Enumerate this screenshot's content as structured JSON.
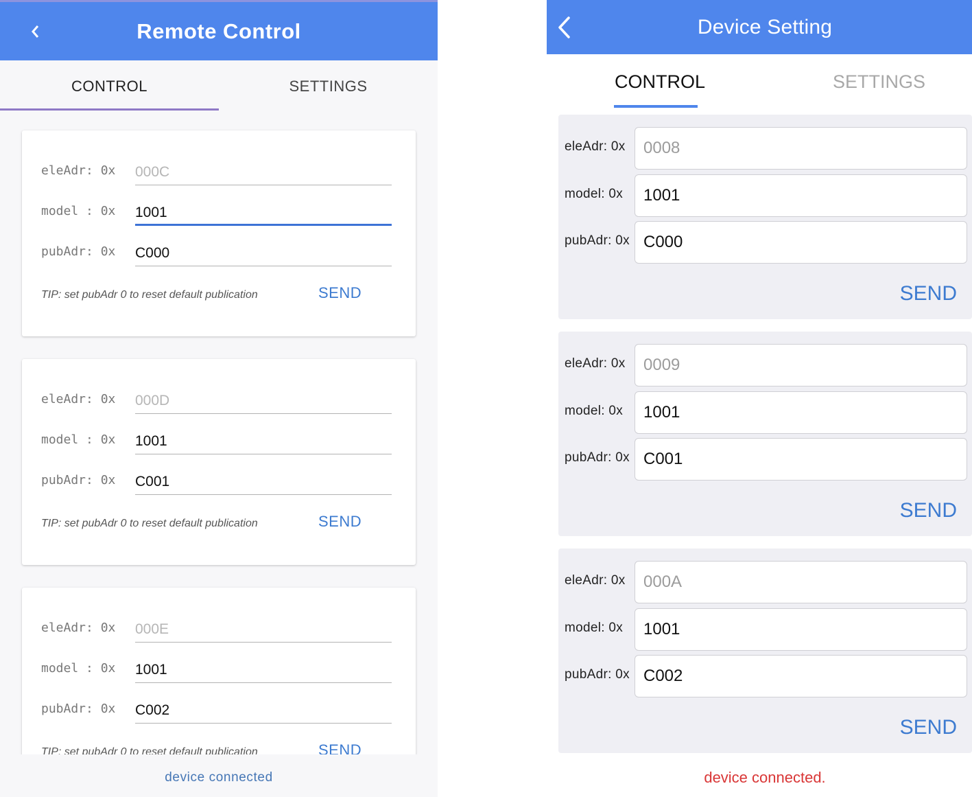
{
  "left": {
    "title": "Remote Control",
    "tabs": [
      "CONTROL",
      "SETTINGS"
    ],
    "label_ele": "eleAdr: 0x",
    "label_model": "model : 0x",
    "label_pub": "pubAdr: 0x",
    "cards": [
      {
        "eleAdr": "000C",
        "model": "1001",
        "pubAdr": "C000",
        "tip": "TIP: set pubAdr 0 to reset default publication",
        "send": "SEND"
      },
      {
        "eleAdr": "000D",
        "model": "1001",
        "pubAdr": "C001",
        "tip": "TIP: set pubAdr 0 to reset default publication",
        "send": "SEND"
      },
      {
        "eleAdr": "000E",
        "model": "1001",
        "pubAdr": "C002",
        "tip": "TIP: set pubAdr 0 to reset default publication",
        "send": "SEND"
      }
    ],
    "status": "device connected"
  },
  "right": {
    "title": "Device Setting",
    "tabs": [
      "CONTROL",
      "SETTINGS"
    ],
    "label_ele": "eleAdr: 0x",
    "label_model": "model: 0x",
    "label_pub": "pubAdr: 0x",
    "cards": [
      {
        "eleAdr": "0008",
        "model": "1001",
        "pubAdr": "C000",
        "send": "SEND"
      },
      {
        "eleAdr": "0009",
        "model": "1001",
        "pubAdr": "C001",
        "send": "SEND"
      },
      {
        "eleAdr": "000A",
        "model": "1001",
        "pubAdr": "C002",
        "send": "SEND"
      }
    ],
    "status": "device connected."
  },
  "colors": {
    "app_bar": "#4f86ec",
    "left_tab_indicator": "#8e79c6",
    "send_text": "#3d7bd0",
    "left_status": "#4576b5",
    "right_status": "#d93636"
  },
  "icons": {
    "back": "chevron-left-icon"
  }
}
